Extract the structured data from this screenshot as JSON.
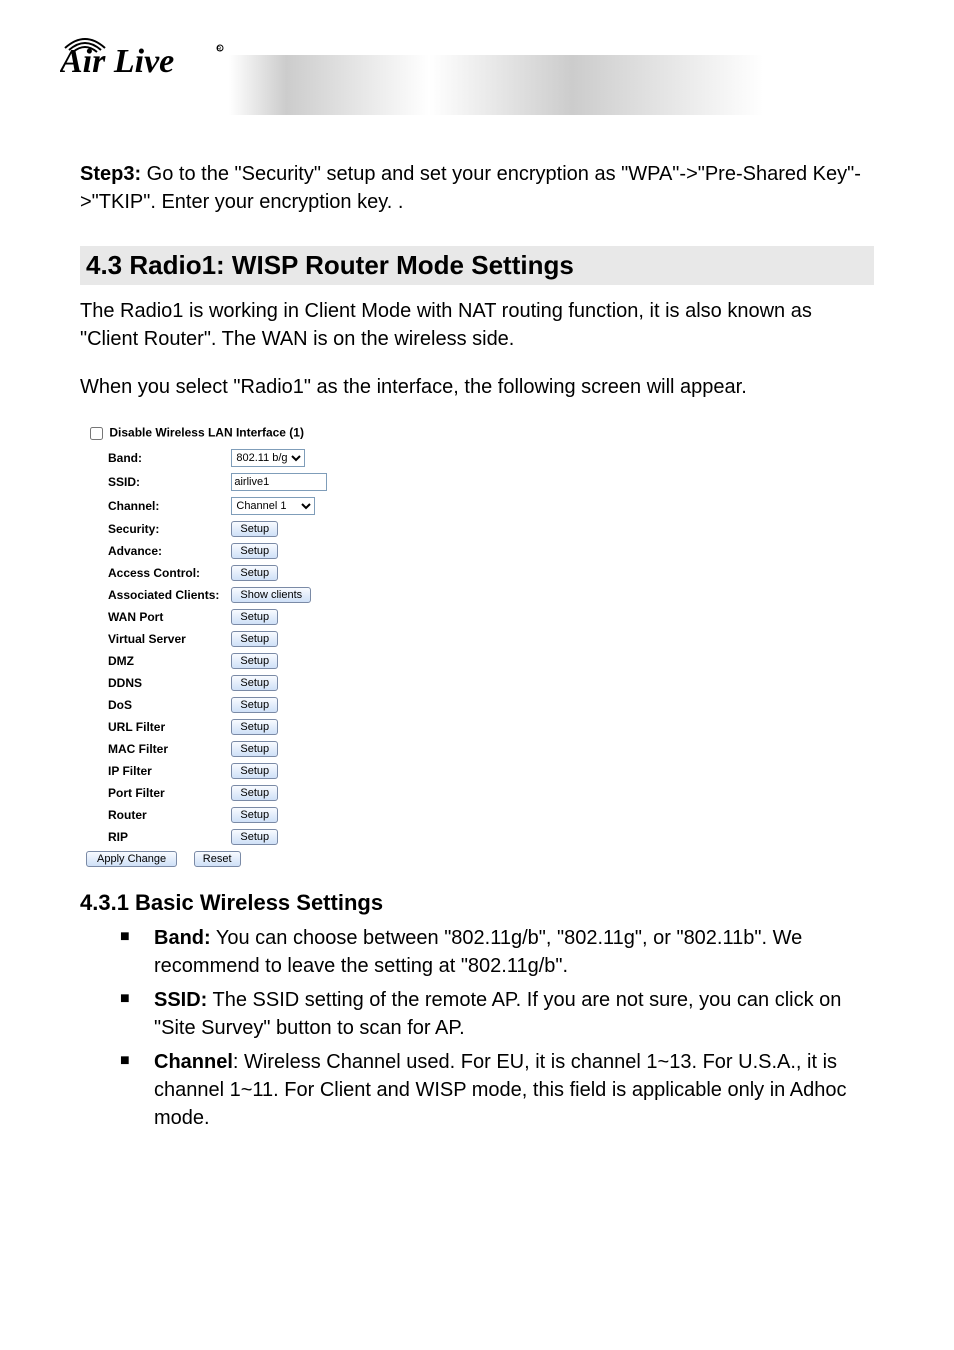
{
  "logo_text": "AirLive",
  "step3": {
    "label": "Step3:",
    "text": " Go to the \"Security\" setup and set your encryption as \"WPA\"->\"Pre-Shared Key\"->\"TKIP\".    Enter your encryption key. ."
  },
  "section": {
    "title": "4.3 Radio1:  WISP  Router  Mode  Settings",
    "para1": "The Radio1 is working in Client Mode with NAT routing function, it is also known as \"Client Router\".    The WAN is on the wireless side.",
    "para2": "When you select \"Radio1\" as the interface, the following screen will appear."
  },
  "form": {
    "disable_label": "Disable Wireless LAN Interface (1)",
    "rows": {
      "band": {
        "label": "Band:",
        "value": "802.11 b/g"
      },
      "ssid": {
        "label": "SSID:",
        "value": "airlive1"
      },
      "channel": {
        "label": "Channel:",
        "value": "Channel 1"
      },
      "security": {
        "label": "Security:",
        "btn": "Setup"
      },
      "advance": {
        "label": "Advance:",
        "btn": "Setup"
      },
      "access_control": {
        "label": "Access Control:",
        "btn": "Setup"
      },
      "associated_clients": {
        "label": "Associated Clients:",
        "btn": "Show clients"
      },
      "wan_port": {
        "label": "WAN Port",
        "btn": "Setup"
      },
      "virtual_server": {
        "label": "Virtual Server",
        "btn": "Setup"
      },
      "dmz": {
        "label": "DMZ",
        "btn": "Setup"
      },
      "ddns": {
        "label": "DDNS",
        "btn": "Setup"
      },
      "dos": {
        "label": "DoS",
        "btn": "Setup"
      },
      "url_filter": {
        "label": "URL Filter",
        "btn": "Setup"
      },
      "mac_filter": {
        "label": "MAC Filter",
        "btn": "Setup"
      },
      "ip_filter": {
        "label": "IP Filter",
        "btn": "Setup"
      },
      "port_filter": {
        "label": "Port Filter",
        "btn": "Setup"
      },
      "router": {
        "label": "Router",
        "btn": "Setup"
      },
      "rip": {
        "label": "RIP",
        "btn": "Setup"
      }
    },
    "apply_btn": "Apply Change",
    "reset_btn": "Reset"
  },
  "sub": {
    "title": "4.3.1 Basic Wireless Settings",
    "items": [
      {
        "label": "Band:",
        "text": "    You can choose between \"802.11g/b\", \"802.11g\", or \"802.11b\".    We recommend to leave the setting at \"802.11g/b\"."
      },
      {
        "label": "SSID:",
        "text": "    The SSID setting of the remote AP.    If you are not sure, you can click on \"Site Survey\" button to scan for AP."
      },
      {
        "label": "Channel",
        "text": ":    Wireless Channel used.    For EU, it is channel 1~13.    For U.S.A., it is channel 1~11.    For Client and WISP mode, this field is applicable only in Adhoc mode."
      }
    ]
  }
}
